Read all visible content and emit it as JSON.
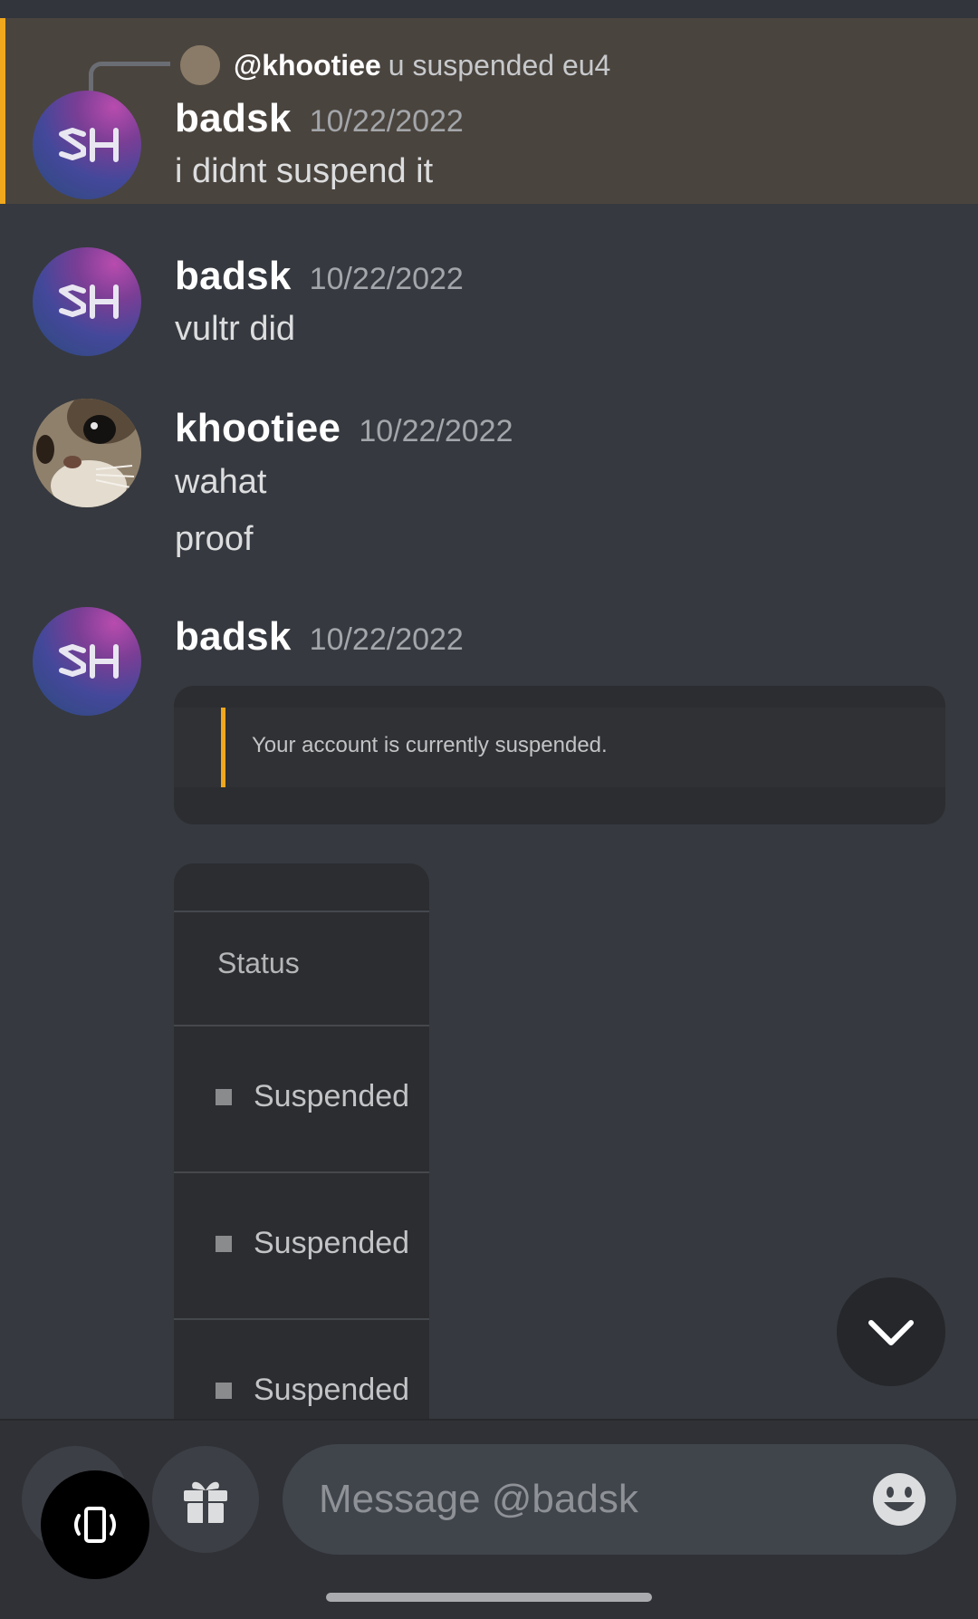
{
  "reply": {
    "mention": "@khootiee",
    "content": "u suspended eu4"
  },
  "messages": [
    {
      "username": "badsk",
      "timestamp": "10/22/2022",
      "lines": [
        "i didnt suspend it"
      ]
    },
    {
      "username": "badsk",
      "timestamp": "10/22/2022",
      "lines": [
        "vultr did"
      ]
    },
    {
      "username": "khootiee",
      "timestamp": "10/22/2022",
      "lines": [
        "wahat",
        "proof"
      ]
    },
    {
      "username": "badsk",
      "timestamp": "10/22/2022",
      "lines": []
    }
  ],
  "avatars": {
    "badsk": {
      "initials": "SH",
      "icon": "sh-logo-avatar"
    },
    "khootiee": {
      "icon": "cat-avatar"
    }
  },
  "attachments": {
    "notice": "Your account is currently suspended.",
    "table": {
      "header": "Status",
      "rows": [
        "Suspended",
        "Suspended",
        "Suspended"
      ]
    }
  },
  "composer": {
    "placeholder": "Message @badsk"
  },
  "icons": {
    "scroll": "chevron-down-icon",
    "add": "plus-icon",
    "gift": "gift-icon",
    "emoji": "emoji-icon",
    "rotate": "rotate-screen-icon"
  },
  "colors": {
    "background": "#36393f",
    "mention_highlight": "#4a443e",
    "mention_bar": "#f0a81e",
    "composer": "#40444b"
  }
}
